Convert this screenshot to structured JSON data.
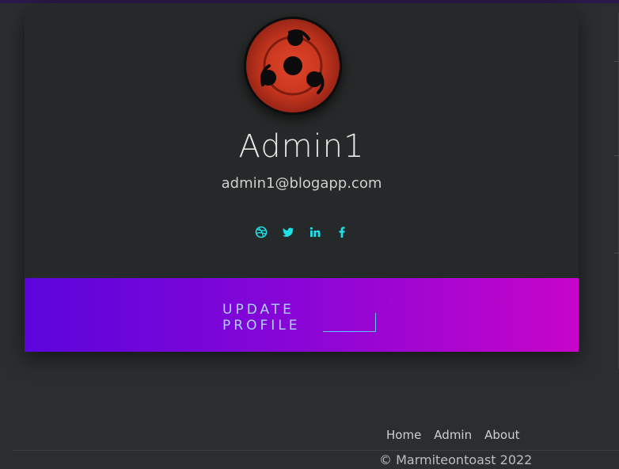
{
  "profile": {
    "name": "Admin1",
    "email": "admin1@blogapp.com",
    "socials": [
      "dribbble-icon",
      "twitter-icon",
      "linkedin-icon",
      "facebook-icon"
    ],
    "update_button": "UPDATE PROFILE"
  },
  "colors": {
    "accent": "#1fe0e6",
    "banner_start": "#5b05dc",
    "banner_end": "#c705c9",
    "button_text": "#a8d4ff",
    "background": "#2b2e30"
  },
  "footer": {
    "nav": [
      "Home",
      "Admin",
      "About"
    ],
    "copyright": "© Marmiteontoast 2022"
  }
}
